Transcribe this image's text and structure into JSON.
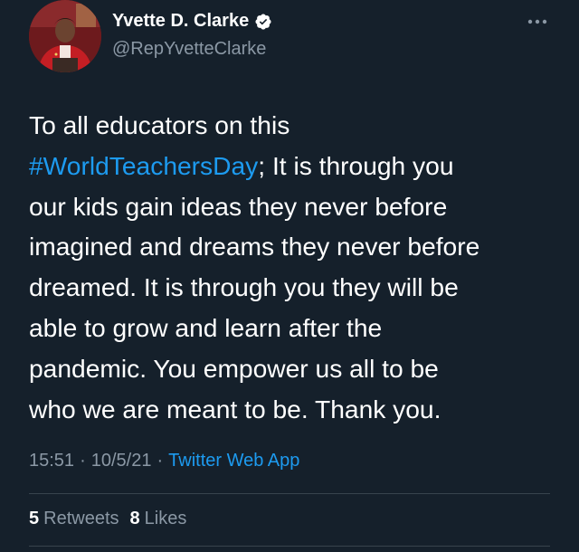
{
  "author": {
    "display_name": "Yvette D. Clarke",
    "handle": "@RepYvetteClarke",
    "verified": true,
    "avatar_icon": "profile-photo"
  },
  "tweet": {
    "lines": [
      {
        "text": "To all educators on this"
      },
      {
        "hashtag": "#WorldTeachersDay",
        "text": "; It is through you"
      },
      {
        "text": "our kids gain ideas they never before"
      },
      {
        "text": "imagined and dreams they never before"
      },
      {
        "text": "dreamed. It is through you they will be"
      },
      {
        "text": "able to grow and learn after the"
      },
      {
        "text": "pandemic. You empower us all to be"
      },
      {
        "text": "who we are meant to be. Thank you."
      }
    ]
  },
  "meta": {
    "time": "15:51",
    "separator": "·",
    "date": "10/5/21",
    "source": "Twitter Web App"
  },
  "stats": {
    "retweets_count": "5",
    "retweets_label": "Retweets",
    "likes_count": "8",
    "likes_label": "Likes"
  },
  "colors": {
    "background": "#15202b",
    "text": "#ffffff",
    "secondary_text": "#8b98a5",
    "accent": "#1d9bf0",
    "divider": "#38444d"
  }
}
